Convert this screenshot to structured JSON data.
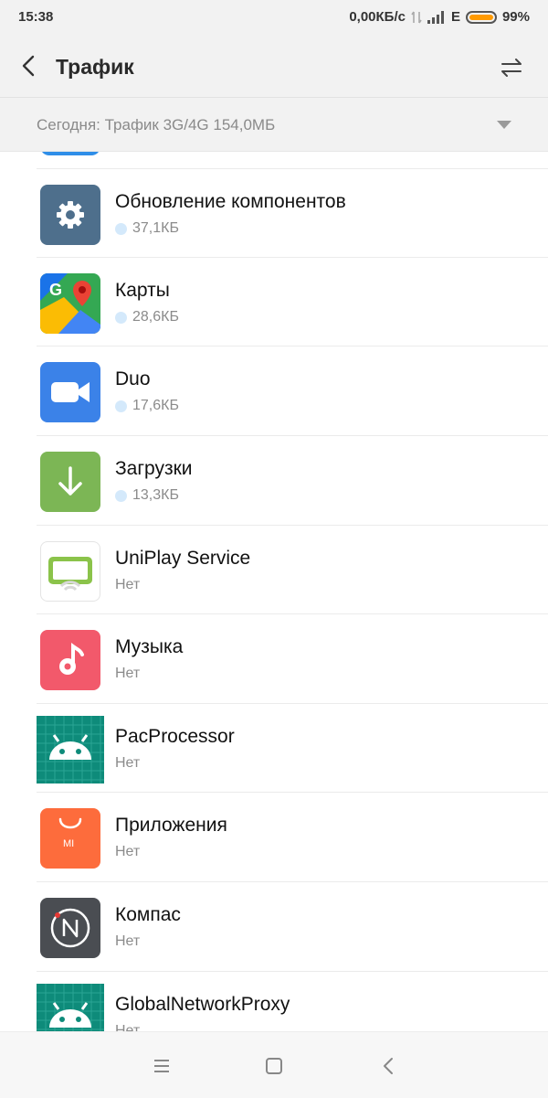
{
  "status": {
    "time": "15:38",
    "speed": "0,00КБ/с",
    "network": "E",
    "battery": "99%",
    "battery_level": 0.99
  },
  "header": {
    "title": "Трафик"
  },
  "filter": {
    "label": "Сегодня: Трафик 3G/4G 154,0МБ"
  },
  "apps": [
    {
      "name": "Обновление компонентов",
      "usage": "37,1КБ",
      "icon": "settings-gear-icon",
      "has_dot": true
    },
    {
      "name": "Карты",
      "usage": "28,6КБ",
      "icon": "maps-icon",
      "has_dot": true
    },
    {
      "name": "Duo",
      "usage": "17,6КБ",
      "icon": "duo-video-icon",
      "has_dot": true
    },
    {
      "name": "Загрузки",
      "usage": "13,3КБ",
      "icon": "download-arrow-icon",
      "has_dot": true
    },
    {
      "name": "UniPlay Service",
      "usage": "Нет",
      "icon": "cast-screen-icon",
      "has_dot": false
    },
    {
      "name": "Музыка",
      "usage": "Нет",
      "icon": "music-note-icon",
      "has_dot": false
    },
    {
      "name": "PacProcessor",
      "usage": "Нет",
      "icon": "android-icon",
      "has_dot": false
    },
    {
      "name": "Приложения",
      "usage": "Нет",
      "icon": "mi-store-icon",
      "has_dot": false
    },
    {
      "name": "Компас",
      "usage": "Нет",
      "icon": "compass-icon",
      "has_dot": false
    },
    {
      "name": "GlobalNetworkProxy",
      "usage": "Нет",
      "icon": "android-icon",
      "has_dot": false
    }
  ],
  "colors": {
    "accent_blue": "#2f8ee8",
    "battery": "#ff9a00",
    "usage_dot": "#d4e9fb"
  }
}
